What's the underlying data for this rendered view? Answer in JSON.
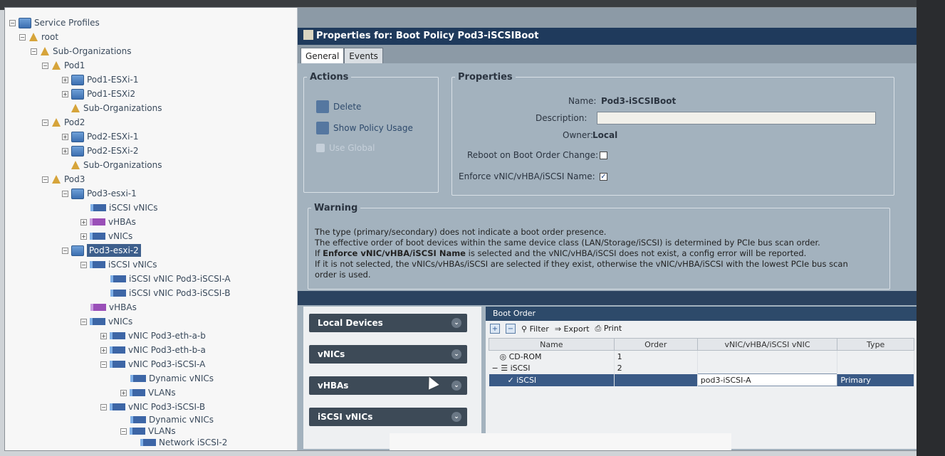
{
  "tree": {
    "root_label": "Service Profiles",
    "root_org": "root",
    "sub_orgs": "Sub-Organizations",
    "pod1": "Pod1",
    "pod1_esxi1": "Pod1-ESXi-1",
    "pod1_esxi2": "Pod1-ESXi2",
    "pod1_sub": "Sub-Organizations",
    "pod2": "Pod2",
    "pod2_esxi1": "Pod2-ESXi-1",
    "pod2_esxi2": "Pod2-ESXi-2",
    "pod2_sub": "Sub-Organizations",
    "pod3": "Pod3",
    "pod3_esxi1": "Pod3-esxi-1",
    "p3e1_iscsi": "iSCSI vNICs",
    "p3e1_vhbas": "vHBAs",
    "p3e1_vnics": "vNICs",
    "pod3_esxi2": "Pod3-esxi-2",
    "p3e2_iscsi": "iSCSI vNICs",
    "p3e2_iscsi_a": "iSCSI vNIC Pod3-iSCSI-A",
    "p3e2_iscsi_b": "iSCSI vNIC Pod3-iSCSI-B",
    "p3e2_vhbas": "vHBAs",
    "p3e2_vnics": "vNICs",
    "vnic_eth_a": "vNIC Pod3-eth-a-b",
    "vnic_eth_b": "vNIC Pod3-eth-b-a",
    "vnic_iscsi_a": "vNIC Pod3-iSCSI-A",
    "dyn_vnics_a": "Dynamic vNICs",
    "vlans_a": "VLANs",
    "vnic_iscsi_b": "vNIC Pod3-iSCSI-B",
    "dyn_vnics_b": "Dynamic vNICs",
    "vlans_b": "VLANs",
    "network": "Network iSCSI-2"
  },
  "window": {
    "title": "Properties for: Boot Policy Pod3-iSCSIBoot"
  },
  "tabs": [
    {
      "label": "General",
      "active": true
    },
    {
      "label": "Events",
      "active": false
    }
  ],
  "actions": {
    "legend": "Actions",
    "delete": "Delete",
    "show_usage": "Show Policy Usage",
    "use_global": "Use Global"
  },
  "properties": {
    "legend": "Properties",
    "name_label": "Name:",
    "name_value": "Pod3-iSCSIBoot",
    "description_label": "Description:",
    "description_value": "",
    "owner_label": "Owner:",
    "owner_value": "Local",
    "reboot_label": "Reboot on Boot Order Change:",
    "reboot_checked": false,
    "enforce_label": "Enforce vNIC/vHBA/iSCSI Name:",
    "enforce_checked": true
  },
  "warning": {
    "legend": "Warning",
    "line1": "The type (primary/secondary) does not indicate a boot order presence.",
    "line2": "The effective order of boot devices within the same device class (LAN/Storage/iSCSI) is determined by PCIe bus scan order.",
    "line3_prefix": "If",
    "line3_bold": "Enforce vNIC/vHBA/iSCSI Name",
    "line3_suffix": "is selected and the vNIC/vHBA/iSCSI does not exist, a config error will be reported.",
    "line4": "If it is not selected, the vNICs/vHBAs/iSCSI are selected if they exist, otherwise the vNIC/vHBA/iSCSI with the lowest PCIe bus scan",
    "line5": "order is used."
  },
  "accordion": [
    {
      "label": "Local Devices"
    },
    {
      "label": "vNICs"
    },
    {
      "label": "vHBAs"
    },
    {
      "label": "iSCSI vNICs"
    }
  ],
  "boot_order": {
    "header": "Boot Order",
    "filter": "Filter",
    "export": "Export",
    "print": "Print",
    "columns": [
      "Name",
      "Order",
      "vNIC/vHBA/iSCSI vNIC",
      "Type"
    ],
    "rows": [
      {
        "name": "CD-ROM",
        "order": "1",
        "vnic": "",
        "type": ""
      },
      {
        "name": "iSCSI",
        "order": "2",
        "vnic": "",
        "type": ""
      },
      {
        "name": "iSCSI",
        "order": "",
        "vnic": "pod3-iSCSI-A",
        "type": "Primary"
      }
    ]
  }
}
